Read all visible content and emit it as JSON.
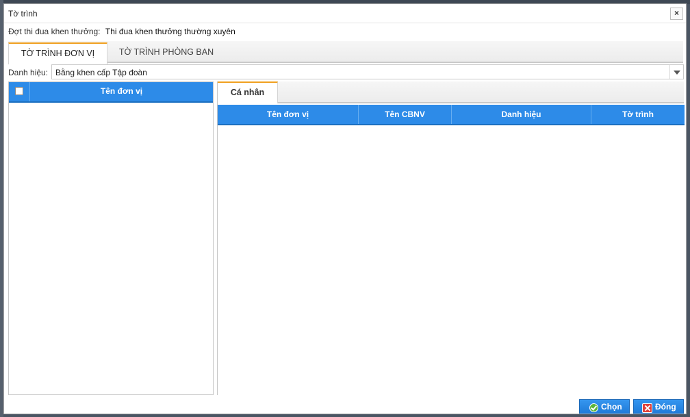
{
  "dialog": {
    "title": "Tờ trình",
    "close_symbol": "×"
  },
  "campaign": {
    "label": "Đợt thi đua khen thưởng:",
    "value": "Thi đua khen thưởng thường xuyên"
  },
  "tabs": [
    {
      "label": "TỜ TRÌNH ĐƠN VỊ",
      "active": true
    },
    {
      "label": "TỜ TRÌNH PHÒNG BAN",
      "active": false
    }
  ],
  "title_filter": {
    "label": "Danh hiệu:",
    "selected": "Bằng khen cấp Tập đoàn"
  },
  "unit_list": {
    "column": "Tên đơn vị",
    "rows": []
  },
  "inner_tabs": [
    {
      "label": "Cá nhân",
      "active": true
    }
  ],
  "person_grid": {
    "columns": [
      "Tên đơn vị",
      "Tên CBNV",
      "Danh hiệu",
      "Tờ trình"
    ],
    "rows": []
  },
  "buttons": {
    "choose": "Chọn",
    "close": "Đóng"
  },
  "icons": {
    "choose": "check-circle-icon",
    "close": "close-x-icon"
  },
  "colors": {
    "header_blue": "#2d8be8",
    "tab_accent": "#f0a020"
  }
}
